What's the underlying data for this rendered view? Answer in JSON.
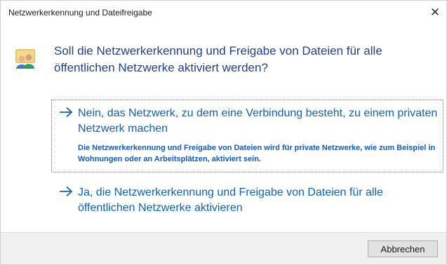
{
  "dialog": {
    "title": "Netzwerkerkennung und Dateifreigabe",
    "close_glyph": "✕",
    "icon": "network-users-icon",
    "question": "Soll die Netzwerkerkennung und Freigabe von Dateien für alle öffentlichen Netzwerke aktiviert werden?"
  },
  "options": [
    {
      "title": "Nein, das Netzwerk, zu dem eine Verbindung besteht, zu einem privaten Netzwerk machen",
      "description": "Die Netzwerkerkennung und Freigabe von Dateien wird für private Netzwerke, wie zum Beispiel in Wohnungen oder an Arbeitsplätzen, aktiviert sein.",
      "icon": "arrow-right-icon",
      "focused": true
    },
    {
      "title": "Ja, die Netzwerkerkennung und Freigabe von Dateien für alle öffentlichen Netzwerke aktivieren",
      "icon": "arrow-right-icon",
      "focused": false
    }
  ],
  "footer": {
    "cancel_label": "Abbrechen"
  },
  "colors": {
    "question_text": "#1f3f8f",
    "link_text": "#0f62b8",
    "footer_bg": "#f0f0f0"
  }
}
